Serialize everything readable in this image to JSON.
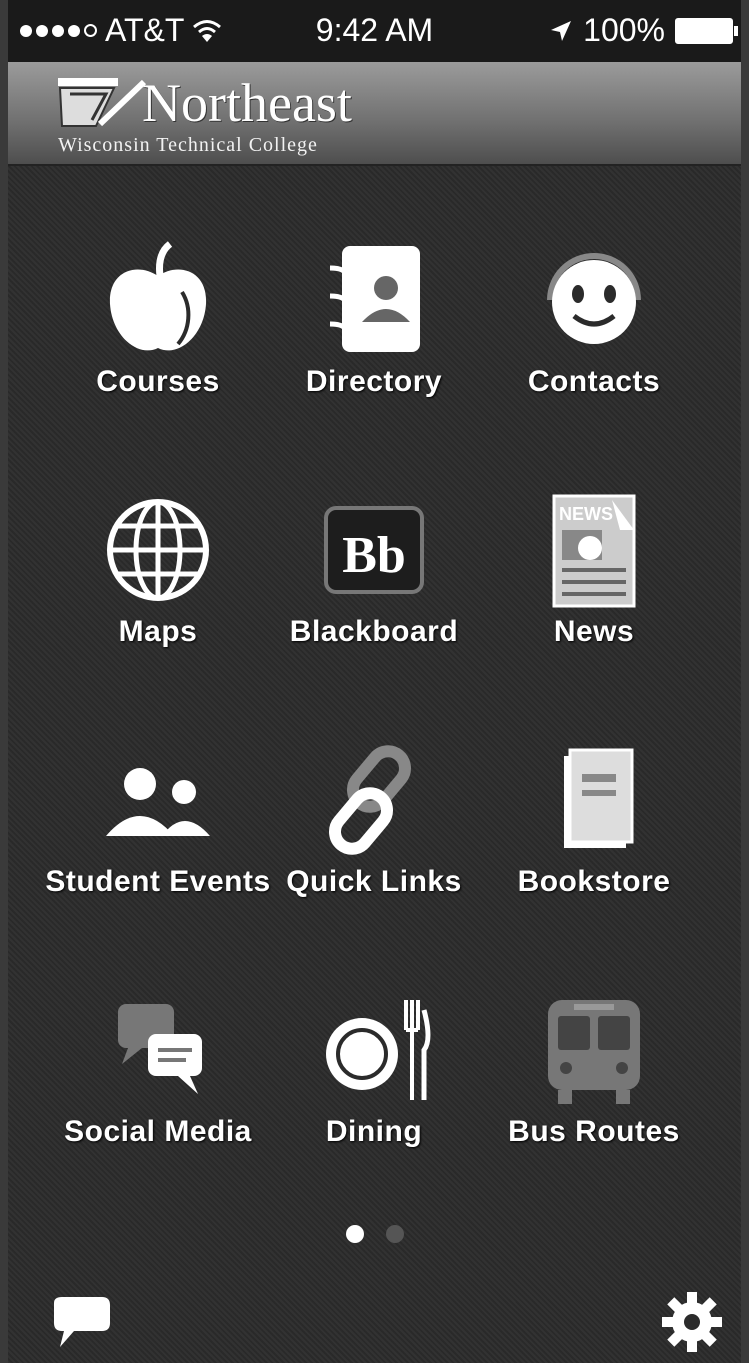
{
  "status": {
    "carrier": "AT&T",
    "time": "9:42 AM",
    "battery": "100%"
  },
  "header": {
    "title": "Northeast",
    "subtitle": "Wisconsin Technical College"
  },
  "tiles": [
    {
      "label": "Courses",
      "icon": "apple-icon"
    },
    {
      "label": "Directory",
      "icon": "address-book-icon"
    },
    {
      "label": "Contacts",
      "icon": "headset-smiley-icon"
    },
    {
      "label": "Maps",
      "icon": "globe-icon"
    },
    {
      "label": "Blackboard",
      "icon": "blackboard-icon",
      "text": "Bb"
    },
    {
      "label": "News",
      "icon": "newspaper-icon",
      "text": "NEWS"
    },
    {
      "label": "Student Events",
      "icon": "people-icon"
    },
    {
      "label": "Quick Links",
      "icon": "chain-link-icon"
    },
    {
      "label": "Bookstore",
      "icon": "book-icon"
    },
    {
      "label": "Social Media",
      "icon": "chat-bubbles-icon"
    },
    {
      "label": "Dining",
      "icon": "plate-fork-knife-icon"
    },
    {
      "label": "Bus Routes",
      "icon": "bus-icon"
    }
  ],
  "pager": {
    "pages": 2,
    "active": 0
  },
  "footer": {
    "left_icon": "speech-bubble-icon",
    "right_icon": "gear-icon"
  },
  "colors": {
    "background": "#2b2b2b",
    "text": "#ffffff",
    "header_top": "#9b9b9b"
  }
}
